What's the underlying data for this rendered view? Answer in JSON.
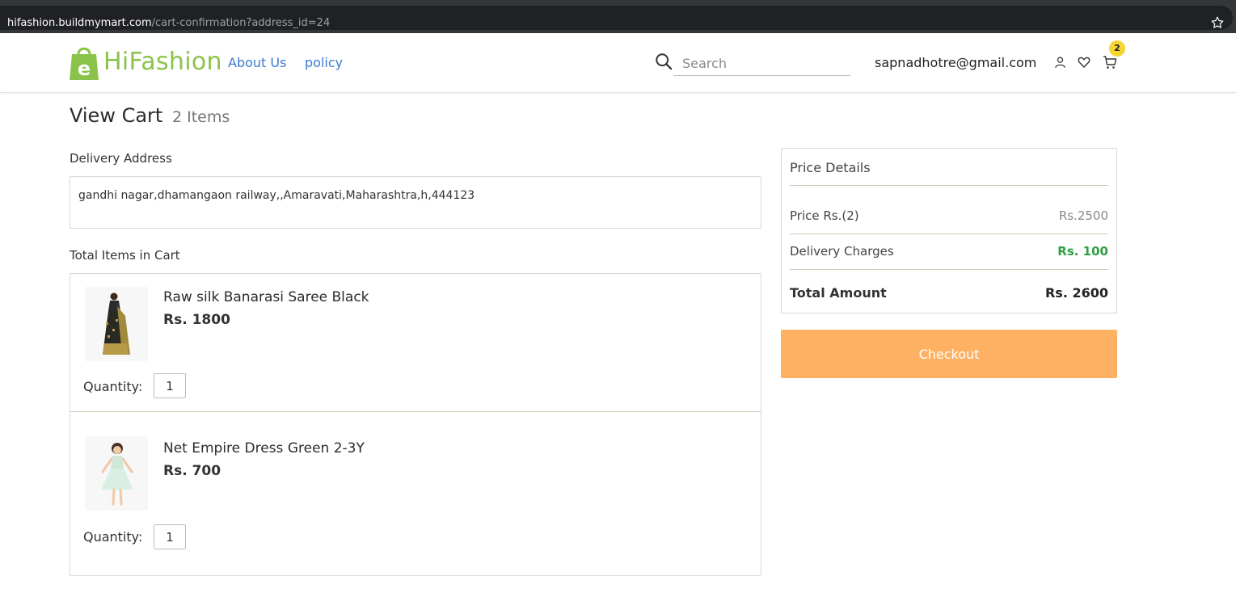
{
  "browser": {
    "url_host": "hifashion.buildmymart.com",
    "url_path": "/cart-confirmation?address_id=24"
  },
  "header": {
    "brand": "HiFashion",
    "nav": [
      {
        "label": "About Us"
      },
      {
        "label": "policy"
      }
    ],
    "search": {
      "placeholder": "Search",
      "value": ""
    },
    "user_email": "sapnadhotre@gmail.com",
    "cart_count": "2",
    "icons": [
      "search-icon",
      "user-icon",
      "heart-icon",
      "cart-icon",
      "star-icon"
    ]
  },
  "page": {
    "title": "View Cart",
    "item_count_text": "2 Items",
    "delivery_label": "Delivery Address",
    "address": "gandhi nagar,dhamangaon railway,,Amaravati,Maharashtra,h,444123",
    "items_label": "Total Items in Cart",
    "items": [
      {
        "name": "Raw silk Banarasi Saree Black",
        "price": "Rs. 1800",
        "quantity_label": "Quantity:",
        "quantity": "1"
      },
      {
        "name": "Net Empire Dress Green 2-3Y",
        "price": "Rs. 700",
        "quantity_label": "Quantity:",
        "quantity": "1"
      }
    ]
  },
  "price_details": {
    "title": "Price Details",
    "rows": [
      {
        "label": "Price Rs.(2)",
        "value": "Rs.2500"
      },
      {
        "label": "Delivery Charges",
        "value": "Rs. 100"
      },
      {
        "label": "Total Amount",
        "value": "Rs. 2600"
      }
    ],
    "checkout_label": "Checkout"
  },
  "colors": {
    "brand_green": "#8bc34a",
    "link_blue": "#3b7bd4",
    "checkout_orange": "#ffb163",
    "delivery_green": "#2ea043",
    "badge_yellow": "#f5d533"
  }
}
